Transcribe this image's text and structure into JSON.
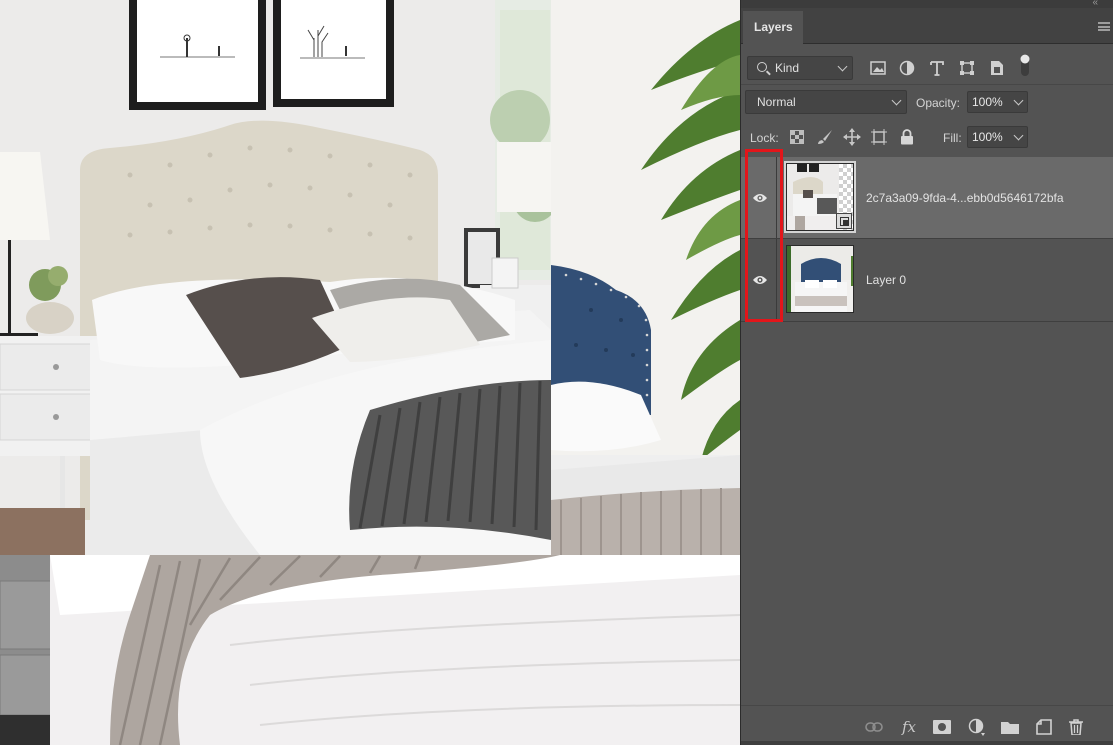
{
  "canvas": {
    "description_colors": {
      "headboard_beige": "#dcd7c9",
      "headboard_blue": "#324f76",
      "bedding_white": "#f4f4f4",
      "throw_gray": "#5a5a5a",
      "wall": "#ecebea"
    }
  },
  "panel": {
    "tab_label": "Layers",
    "filter": {
      "kind_label": "Kind",
      "icons": [
        "image-filter-icon",
        "adjustment-filter-icon",
        "type-filter-icon",
        "shape-filter-icon",
        "smart-object-filter-icon",
        "filter-toggle-icon"
      ]
    },
    "blend": {
      "mode": "Normal",
      "opacity_label": "Opacity:",
      "opacity_value": "100%"
    },
    "lock": {
      "label": "Lock:",
      "icons": [
        "lock-transparent-icon",
        "lock-image-icon",
        "lock-position-icon",
        "lock-artboard-icon",
        "lock-all-icon"
      ],
      "fill_label": "Fill:",
      "fill_value": "100%"
    },
    "layers": [
      {
        "name": "2c7a3a09-9fda-4...ebb0d5646172bfa",
        "visible": true,
        "selected": true,
        "smart_object": true
      },
      {
        "name": "Layer 0",
        "visible": true,
        "selected": false,
        "smart_object": false
      }
    ],
    "bottom_icons": [
      "link-layers-icon",
      "fx-icon",
      "mask-icon",
      "adjustment-layer-icon",
      "group-folder-icon",
      "new-layer-icon",
      "trash-icon"
    ],
    "fx_label": "fx",
    "colors": {
      "panel_bg": "#535353",
      "selected_row": "#6a6a6a",
      "highlight": "#e3151a"
    }
  }
}
